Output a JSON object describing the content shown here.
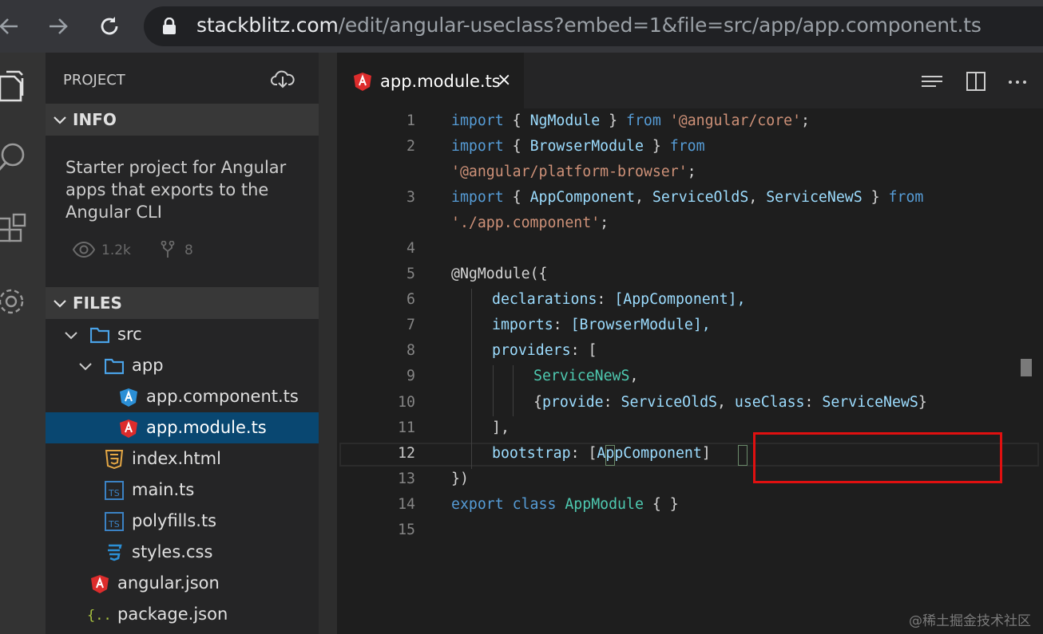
{
  "browser": {
    "url_host": "stackblitz.com",
    "url_path": "/edit/angular-useclass?embed=1&file=src/app/app.component.ts",
    "icons": [
      "back-arrow-icon",
      "forward-arrow-icon",
      "reload-icon",
      "lock-icon"
    ]
  },
  "activity_bar": {
    "icons": [
      "files-icon",
      "search-icon",
      "extensions-icon",
      "settings-gear-icon"
    ]
  },
  "sidebar": {
    "title": "PROJECT",
    "info_header": "INFO",
    "description": "Starter project for Angular apps that exports to the Angular CLI",
    "views": "1.2k",
    "forks": "8",
    "files_header": "FILES",
    "tree": [
      {
        "label": "src",
        "kind": "folder-open"
      },
      {
        "label": "app",
        "kind": "folder-open"
      },
      {
        "label": "app.component.ts",
        "kind": "angular-ts",
        "icon_color": "#2b8fd6"
      },
      {
        "label": "app.module.ts",
        "kind": "angular",
        "icon_color": "#dd2c2c",
        "selected": true
      },
      {
        "label": "index.html",
        "kind": "html5",
        "icon_color": "#e4a745"
      },
      {
        "label": "main.ts",
        "kind": "typescript",
        "icon_color": "#3b82c4"
      },
      {
        "label": "polyfills.ts",
        "kind": "typescript",
        "icon_color": "#3b82c4"
      },
      {
        "label": "styles.css",
        "kind": "css3",
        "icon_color": "#2b8fd6"
      },
      {
        "label": "angular.json",
        "kind": "angular",
        "icon_color": "#dd2c2c"
      },
      {
        "label": "package.json",
        "kind": "json",
        "icon_color": "#a8c23f"
      }
    ]
  },
  "editor": {
    "tab_label": "app.module.ts",
    "tab_close": "×",
    "toolbar_icons": [
      "split-view-list-icon",
      "split-editor-icon",
      "more-icon"
    ],
    "line_numbers": [
      "1",
      "2",
      "",
      "3",
      "",
      "4",
      "5",
      "6",
      "7",
      "8",
      "9",
      "10",
      "11",
      "12",
      "13",
      "14",
      "15"
    ],
    "current_line": "12",
    "code": {
      "l1_import": "import",
      "l1_open": " { ",
      "l1_name": "NgModule",
      "l1_close": " } ",
      "l1_from": "from",
      "l1_mod": " '@angular/core'",
      "l1_semi": ";",
      "l2_import": "import",
      "l2_open": " { ",
      "l2_name": "BrowserModule",
      "l2_close": " } ",
      "l2_from": "from",
      "l2b_mod": "'@angular/platform-browser'",
      "l2b_semi": ";",
      "l3_import": "import",
      "l3_open": " { ",
      "l3_a": "AppComponent",
      "l3_c1": ", ",
      "l3_b": "ServiceOldS",
      "l3_c2": ", ",
      "l3_c": "ServiceNewS",
      "l3_close": " } ",
      "l3_from": "from",
      "l3b_mod": "'./app.component'",
      "l3b_semi": ";",
      "l5_dec": "@NgModule",
      "l5_open": "({",
      "l6_key": "declarations",
      "l6_colon": ": ",
      "l6_val": "[AppComponent],",
      "l7_key": "imports",
      "l7_colon": ": ",
      "l7_val": "[BrowserModule],",
      "l8_key": "providers",
      "l8_colon": ": ",
      "l8_val": "[",
      "l9_val": "ServiceNewS",
      "l9_comma": ",",
      "l10_open": "{",
      "l10_k1": "provide",
      "l10_c1": ": ",
      "l10_v1": "ServiceOldS",
      "l10_comma": ", ",
      "l10_k2": "useClass",
      "l10_c2": ": ",
      "l10_v2": "ServiceNewS",
      "l10_close": "}",
      "l11_val": "],",
      "l12_key": "bootstrap",
      "l12_colon": ": ",
      "l12_ob": "[",
      "l12_val": "AppComponent",
      "l12_cb": "]",
      "l13_val": "})",
      "l14_export": "export",
      "l14_class": " class ",
      "l14_name": "AppModule",
      "l14_body": " { }"
    }
  },
  "watermark": "@稀土掘金技术社区",
  "colors": {
    "keyword": "#569cd6",
    "string": "#ce9178",
    "identifier": "#9cdcfe",
    "class": "#4ec9b0",
    "highlight_box": "#e01010",
    "selection": "#094771"
  }
}
